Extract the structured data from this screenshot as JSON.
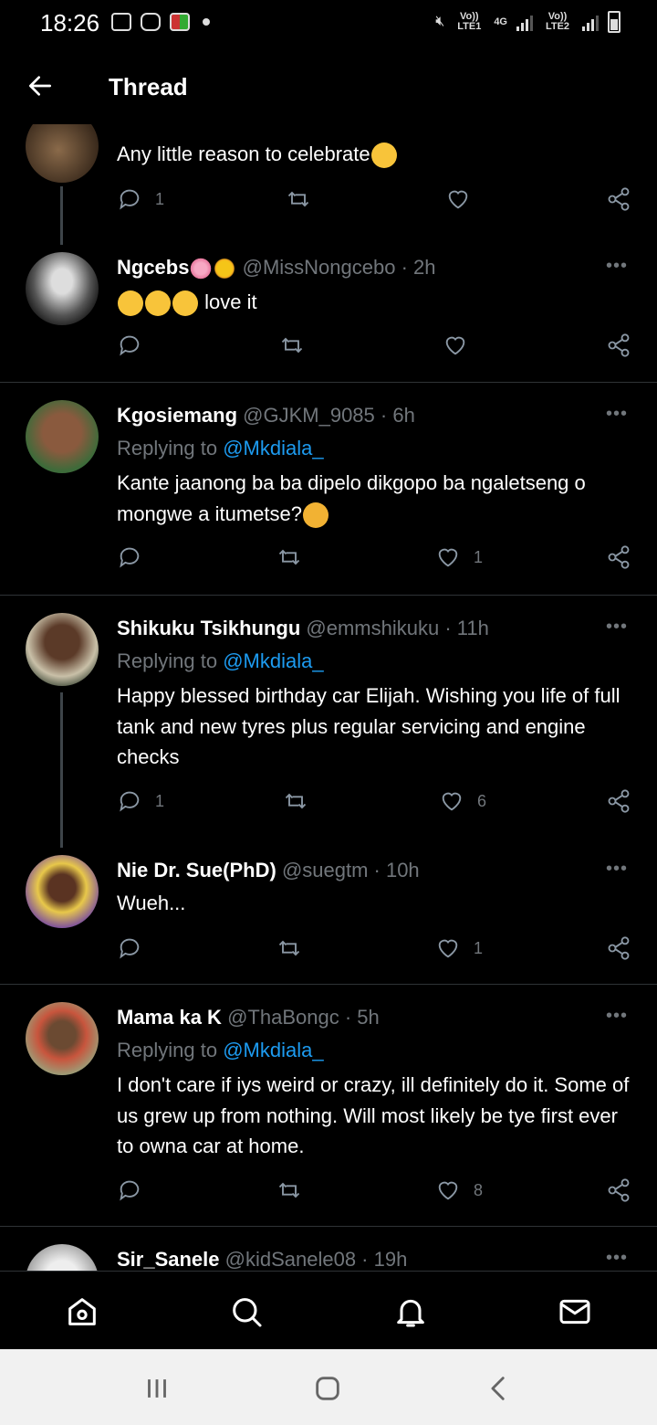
{
  "status_bar": {
    "time": "18:26",
    "sim1_label": "Vo)) LTE1",
    "network": "4G",
    "sim2_label": "Vo)) LTE2"
  },
  "header": {
    "title": "Thread"
  },
  "tweets": [
    {
      "name": "",
      "handle": "",
      "body": "Any little reason to celebrate",
      "body_emoji": "grinning-sweat",
      "replies": "1",
      "retweets": "",
      "likes": "",
      "thread_line": true
    },
    {
      "name": "Ngcebs",
      "handle": "@MissNongcebo · 2h",
      "name_emojis": [
        "cherry-blossom",
        "sun"
      ],
      "body": "love it",
      "body_prefix_emojis": [
        "laughing-crying",
        "laughing-crying",
        "laughing-crying"
      ],
      "replies": "",
      "retweets": "",
      "likes": ""
    },
    {
      "name": "Kgosiemang",
      "handle": "@GJKM_9085 · 6h",
      "reply_prefix": "Replying to ",
      "reply_mention": "@Mkdiala_",
      "body": "Kante jaanong ba ba dipelo dikgopo ba ngaletseng o mongwe a itumetse?",
      "body_emoji": "thinking-face",
      "replies": "",
      "retweets": "",
      "likes": "1"
    },
    {
      "name": "Shikuku Tsikhungu",
      "handle": "@emmshikuku · 11h",
      "reply_prefix": "Replying to ",
      "reply_mention": "@Mkdiala_",
      "body": "Happy blessed birthday car Elijah. Wishing you life of full tank and new tyres plus regular servicing and engine checks",
      "replies": "1",
      "retweets": "",
      "likes": "6",
      "thread_line": true
    },
    {
      "name": "Nie Dr. Sue(PhD)",
      "handle": "@suegtm · 10h",
      "body": "Wueh...",
      "replies": "",
      "retweets": "",
      "likes": "1"
    },
    {
      "name": "Mama ka K",
      "handle": "@ThaBongc · 5h",
      "reply_prefix": "Replying to ",
      "reply_mention": "@Mkdiala_",
      "body": "I don't care if iys weird or crazy, ill definitely do it. Some of us grew up from nothing. Will most likely be tye first ever to owna car at home.",
      "replies": "",
      "retweets": "",
      "likes": "8"
    },
    {
      "name": "Sir_Sanele",
      "handle": "@kidSanele08 · 19h"
    }
  ],
  "more_label": "•••",
  "colors": {
    "accent": "#1d9bf0",
    "muted": "#71767b",
    "divider": "#2f3336",
    "background": "#000000"
  },
  "bottom_nav": [
    "home-icon",
    "search-icon",
    "notifications-icon",
    "messages-icon"
  ],
  "system_nav": [
    "recent-apps-icon",
    "home-button-icon",
    "back-icon"
  ]
}
